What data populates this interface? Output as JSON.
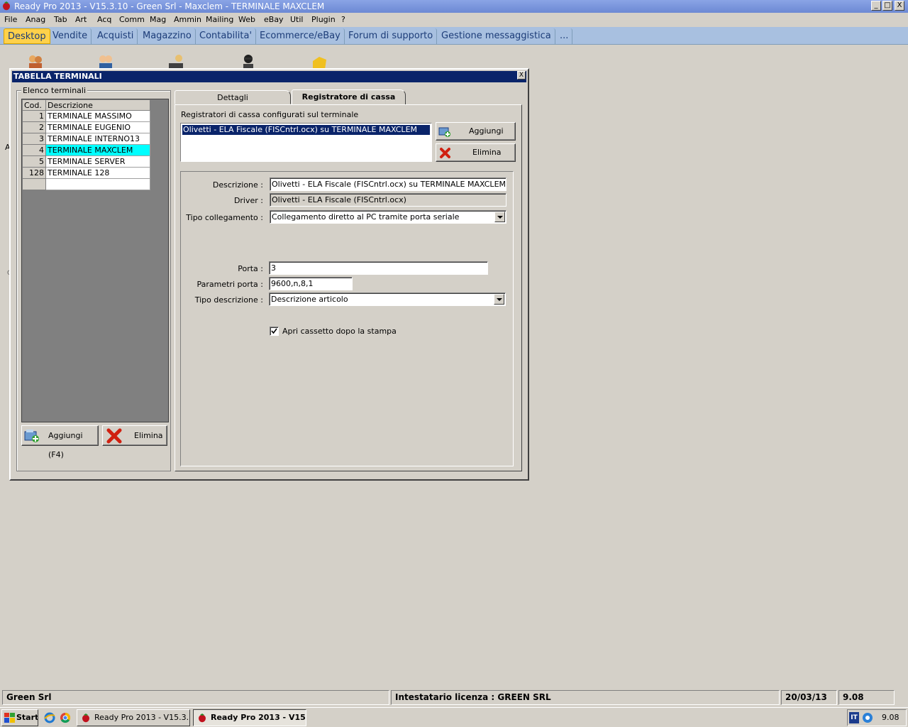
{
  "window": {
    "title": "Ready Pro 2013 - V15.3.10 - Green Srl - Maxclem - TERMINALE MAXCLEM",
    "minimize": "_",
    "maximize": "□",
    "close": "X"
  },
  "menu": [
    "File",
    "Anag",
    "Tab",
    "Art",
    "Acq",
    "Comm",
    "Mag",
    "Ammin",
    "Mailing",
    "Web",
    "eBay",
    "Util",
    "Plugin",
    "?"
  ],
  "main_tabs": [
    "Desktop",
    "Vendite",
    "Acquisti",
    "Magazzino",
    "Contabilita'",
    "Ecommerce/eBay",
    "Forum di supporto",
    "Gestione messaggistica",
    "..."
  ],
  "side_letters": [
    "A",
    "C"
  ],
  "dialog": {
    "title": "TABELLA TERMINALI",
    "close": "X",
    "terminals_group_label": "Elenco terminali",
    "grid": {
      "columns": [
        "Cod.",
        "Descrizione"
      ],
      "rows": [
        {
          "cod": "1",
          "desc": "TERMINALE MASSIMO"
        },
        {
          "cod": "2",
          "desc": "TERMINALE EUGENIO"
        },
        {
          "cod": "3",
          "desc": "TERMINALE INTERNO13"
        },
        {
          "cod": "4",
          "desc": "TERMINALE MAXCLEM"
        },
        {
          "cod": "5",
          "desc": "TERMINALE SERVER"
        },
        {
          "cod": "128",
          "desc": "TERMINALE 128"
        },
        {
          "cod": "",
          "desc": ""
        }
      ]
    },
    "add_button": "Aggiungi (F4)",
    "delete_button": "Elimina",
    "tabs": [
      "Dettagli",
      "Registratore di cassa"
    ],
    "registers_label": "Registratori di cassa configurati sul terminale",
    "registers_list": [
      "Olivetti - ELA Fiscale (FISCntrl.ocx) su TERMINALE MAXCLEM"
    ],
    "reg_add_button": "Aggiungi",
    "reg_delete_button": "Elimina",
    "fields": {
      "descrizione_label": "Descrizione :",
      "descrizione_value": "Olivetti - ELA Fiscale (FISCntrl.ocx) su TERMINALE MAXCLEM",
      "driver_label": "Driver :",
      "driver_value": "Olivetti - ELA Fiscale (FISCntrl.ocx)",
      "tipo_collegamento_label": "Tipo collegamento :",
      "tipo_collegamento_value": "Collegamento diretto al PC tramite porta seriale",
      "porta_label": "Porta :",
      "porta_value": "3",
      "parametri_label": "Parametri porta :",
      "parametri_value": "9600,n,8,1",
      "tipo_descrizione_label": "Tipo descrizione :",
      "tipo_descrizione_value": "Descrizione articolo",
      "apri_cassetto_label": "Apri cassetto dopo la stampa",
      "apri_cassetto_checked": true
    }
  },
  "status": {
    "company": "Green Srl",
    "license": "Intestatario licenza : GREEN SRL",
    "date": "20/03/13",
    "time": "9.08"
  },
  "taskbar": {
    "start": "Start",
    "tasks": [
      "Ready Pro 2013 - V15.3....",
      "Ready Pro 2013 - V15...."
    ],
    "tray_time": "9.08",
    "tray_lang": "IT"
  },
  "colors": {
    "selected_row": "#00ffff",
    "dialog_title": "#0a246a",
    "active_tab": "#ffd14a",
    "list_selection": "#0a246a"
  }
}
